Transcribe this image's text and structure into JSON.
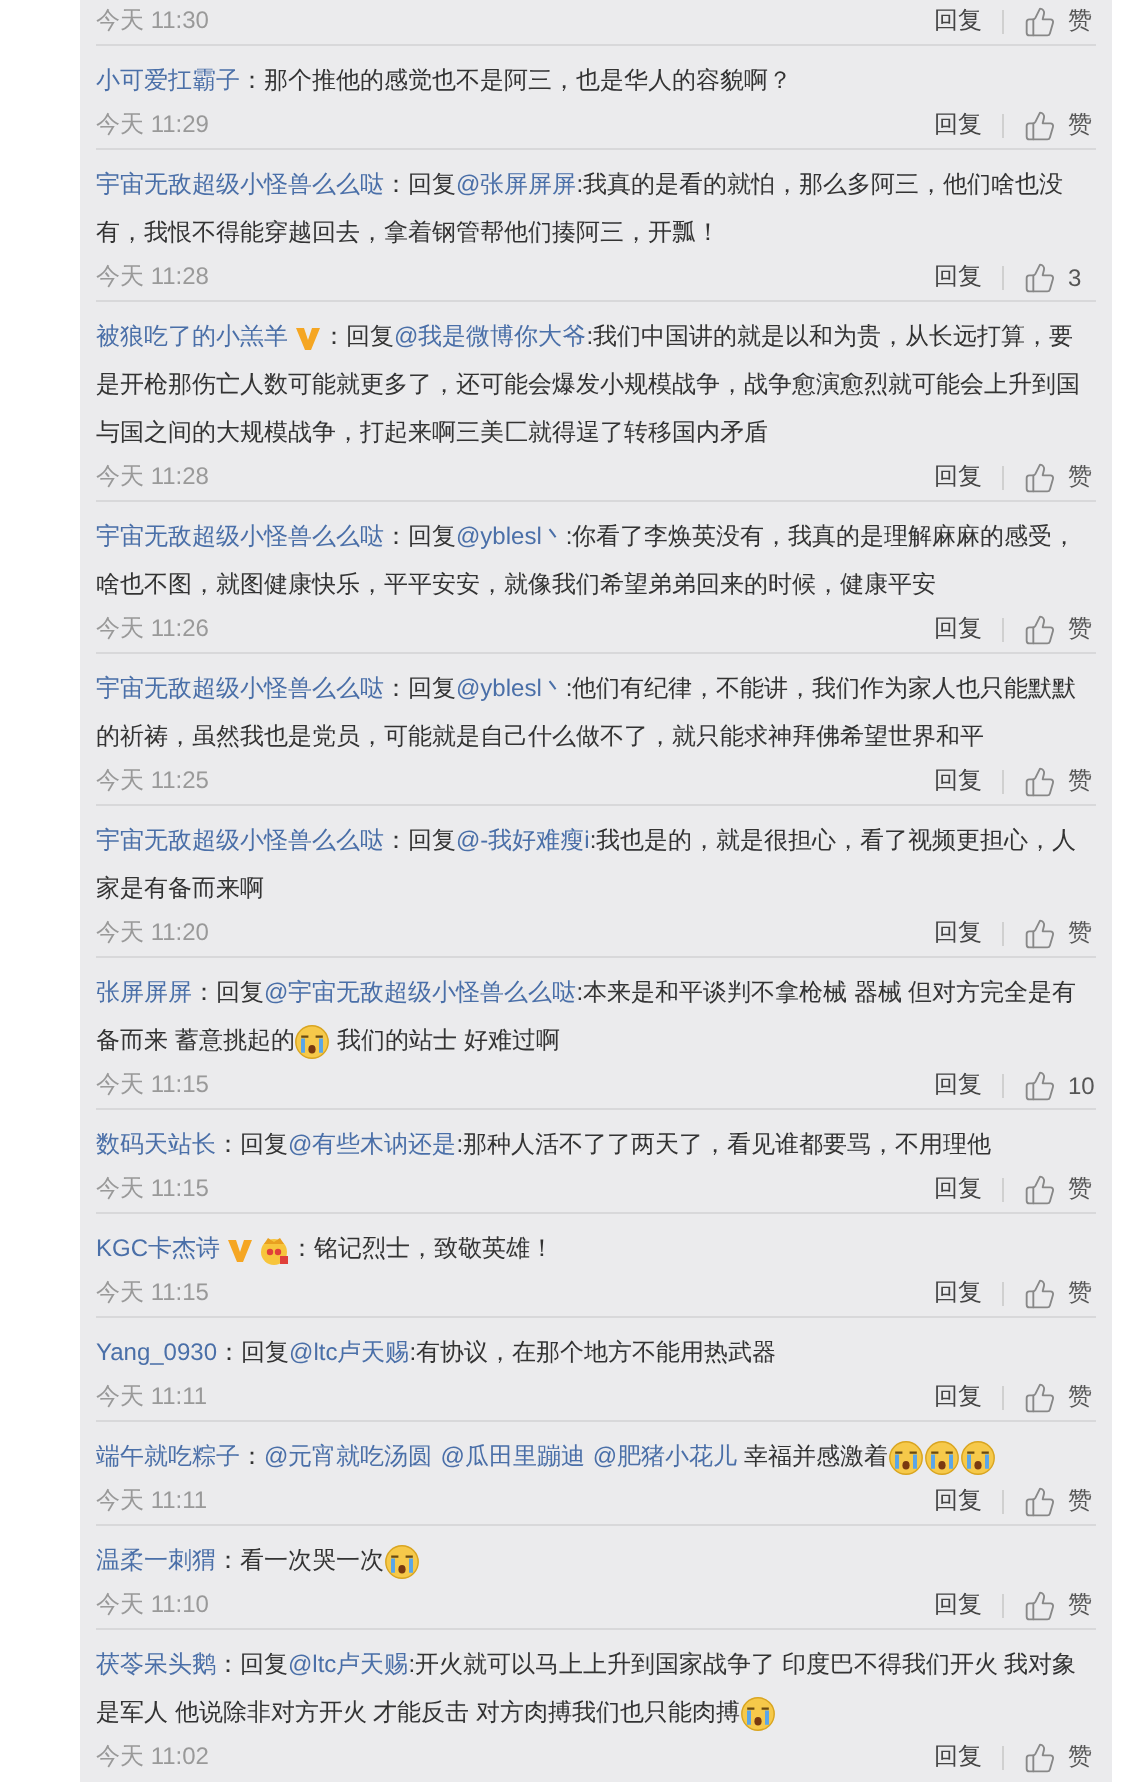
{
  "comments": [
    {
      "time": "今天 11:30",
      "reply": "回复",
      "likes": "赞"
    },
    {
      "user": "小可爱扛霸子",
      "segments": [
        {
          "kind": "text",
          "text": "：那个推他的感觉也不是阿三，也是华人的容貌啊？"
        }
      ],
      "time": "今天 11:29",
      "reply": "回复",
      "likes": "赞"
    },
    {
      "user": "宇宙无敌超级小怪兽么么哒",
      "segments": [
        {
          "kind": "text",
          "text": "：回复"
        },
        {
          "kind": "mention",
          "text": "@张屏屏屏"
        },
        {
          "kind": "text",
          "text": ":我真的是看的就怕，那么多阿三，他们啥也没有，我恨不得能穿越回去，拿着钢管帮他们揍阿三，开瓢！"
        }
      ],
      "time": "今天 11:28",
      "reply": "回复",
      "likes": "3"
    },
    {
      "user": "被狼吃了的小羔羊",
      "verified": true,
      "segments": [
        {
          "kind": "text",
          "text": "：回复"
        },
        {
          "kind": "mention",
          "text": "@我是微博你大爷"
        },
        {
          "kind": "text",
          "text": ":我们中国讲的就是以和为贵，从长远打算，要是开枪那伤亡人数可能就更多了，还可能会爆发小规模战争，战争愈演愈烈就可能会上升到国与国之间的大规模战争，打起来啊三美匚就得逞了转移国内矛盾"
        }
      ],
      "time": "今天 11:28",
      "reply": "回复",
      "likes": "赞"
    },
    {
      "user": "宇宙无敌超级小怪兽么么哒",
      "segments": [
        {
          "kind": "text",
          "text": "：回复"
        },
        {
          "kind": "mention",
          "text": "@yblesl丶"
        },
        {
          "kind": "text",
          "text": ":你看了李焕英没有，我真的是理解麻麻的感受，啥也不图，就图健康快乐，平平安安，就像我们希望弟弟回来的时候，健康平安"
        }
      ],
      "time": "今天 11:26",
      "reply": "回复",
      "likes": "赞"
    },
    {
      "user": "宇宙无敌超级小怪兽么么哒",
      "segments": [
        {
          "kind": "text",
          "text": "：回复"
        },
        {
          "kind": "mention",
          "text": "@yblesl丶"
        },
        {
          "kind": "text",
          "text": ":他们有纪律，不能讲，我们作为家人也只能默默的祈祷，虽然我也是党员，可能就是自己什么做不了，就只能求神拜佛希望世界和平"
        }
      ],
      "time": "今天 11:25",
      "reply": "回复",
      "likes": "赞"
    },
    {
      "user": "宇宙无敌超级小怪兽么么哒",
      "segments": [
        {
          "kind": "text",
          "text": "：回复"
        },
        {
          "kind": "mention",
          "text": "@-我好难瘦i"
        },
        {
          "kind": "text",
          "text": ":我也是的，就是很担心，看了视频更担心，人家是有备而来啊"
        }
      ],
      "time": "今天 11:20",
      "reply": "回复",
      "likes": "赞"
    },
    {
      "user": "张屏屏屏",
      "segments": [
        {
          "kind": "text",
          "text": "：回复"
        },
        {
          "kind": "mention",
          "text": "@宇宙无敌超级小怪兽么么哒"
        },
        {
          "kind": "text",
          "text": ":本来是和平谈判不拿枪械 器械  但对方完全是有备而来  蓄意挑起的"
        },
        {
          "kind": "emoji"
        },
        {
          "kind": "text",
          "text": " 我们的站士  好难过啊"
        }
      ],
      "time": "今天 11:15",
      "reply": "回复",
      "likes": "10"
    },
    {
      "user": "数码天站长",
      "segments": [
        {
          "kind": "text",
          "text": "：回复"
        },
        {
          "kind": "mention",
          "text": "@有些木讷还是"
        },
        {
          "kind": "text",
          "text": ":那种人活不了了两天了，看见谁都要骂，不用理他"
        }
      ],
      "time": "今天 11:15",
      "reply": "回复",
      "likes": "赞"
    },
    {
      "user": "KGC卡杰诗",
      "verified": true,
      "badge": true,
      "segments": [
        {
          "kind": "text",
          "text": "：铭记烈士，致敬英雄！"
        }
      ],
      "time": "今天 11:15",
      "reply": "回复",
      "likes": "赞"
    },
    {
      "user": "Yang_0930",
      "segments": [
        {
          "kind": "text",
          "text": "：回复"
        },
        {
          "kind": "mention",
          "text": "@ltc卢天赐"
        },
        {
          "kind": "text",
          "text": ":有协议，在那个地方不能用热武器"
        }
      ],
      "time": "今天 11:11",
      "reply": "回复",
      "likes": "赞"
    },
    {
      "user": "端午就吃粽子",
      "segments": [
        {
          "kind": "text",
          "text": "："
        },
        {
          "kind": "mention",
          "text": "@元宵就吃汤圆"
        },
        {
          "kind": "mention",
          "text": "@瓜田里蹦迪"
        },
        {
          "kind": "mention",
          "text": "@肥猪小花儿"
        },
        {
          "kind": "text",
          "text": " 幸福并感激着"
        },
        {
          "kind": "emoji"
        },
        {
          "kind": "emoji"
        },
        {
          "kind": "emoji"
        }
      ],
      "time": "今天 11:11",
      "reply": "回复",
      "likes": "赞"
    },
    {
      "user": "温柔一刺猬",
      "segments": [
        {
          "kind": "text",
          "text": "：看一次哭一次"
        },
        {
          "kind": "emoji"
        }
      ],
      "time": "今天 11:10",
      "reply": "回复",
      "likes": "赞"
    },
    {
      "user": "茯苓呆头鹅",
      "segments": [
        {
          "kind": "text",
          "text": "：回复"
        },
        {
          "kind": "mention",
          "text": "@ltc卢天赐"
        },
        {
          "kind": "text",
          "text": ":开火就可以马上上升到国家战争了  印度巴不得我们开火 我对象是军人 他说除非对方开火 才能反击 对方肉搏我们也只能肉搏"
        },
        {
          "kind": "emoji"
        }
      ],
      "time": "今天 11:02",
      "reply": "回复",
      "likes": "赞"
    }
  ]
}
